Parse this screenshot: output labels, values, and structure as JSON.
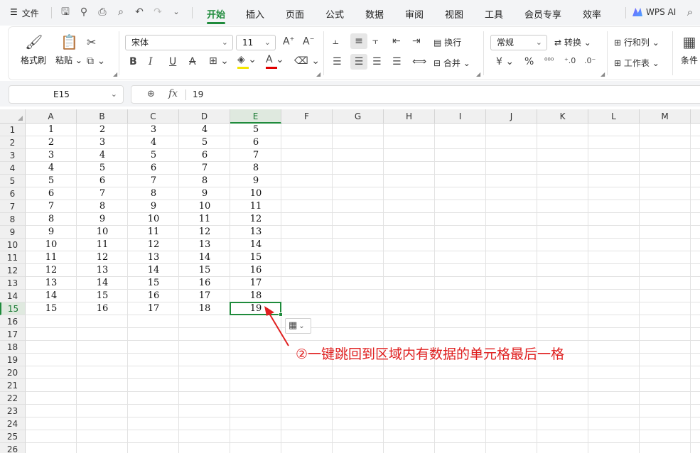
{
  "menubar": {
    "menu_label": "文件",
    "tabs": [
      "开始",
      "插入",
      "页面",
      "公式",
      "数据",
      "审阅",
      "视图",
      "工具",
      "会员专享",
      "效率"
    ],
    "active_tab": "开始",
    "ai_label": "WPS AI"
  },
  "ribbon": {
    "format_painter": "格式刷",
    "paste": "粘贴",
    "font_name": "宋体",
    "font_size": "11",
    "wrap": "换行",
    "merge": "合并",
    "number_format": "常规",
    "convert": "转换",
    "row_col": "行和列",
    "worksheet": "工作表",
    "conditional": "条件",
    "bold": "B",
    "italic": "I",
    "underline": "U",
    "strike": "A",
    "currency": "¥",
    "percent": "%",
    "font_color_hex": "#e00000",
    "fill_color_hex": "#f5e600"
  },
  "formula": {
    "name_box": "E15",
    "fx_label": "fx",
    "value": "19"
  },
  "grid": {
    "columns": [
      "A",
      "B",
      "C",
      "D",
      "E",
      "F",
      "G",
      "H",
      "I",
      "J",
      "K",
      "L",
      "M"
    ],
    "row_numbers": [
      "1",
      "2",
      "3",
      "4",
      "5",
      "6",
      "7",
      "8",
      "9",
      "10",
      "11",
      "12",
      "13",
      "14",
      "15",
      "16",
      "17",
      "18",
      "19",
      "20",
      "21",
      "22",
      "23",
      "24",
      "25",
      "26"
    ],
    "active_column": "E",
    "active_row": "15",
    "data": [
      [
        "1",
        "2",
        "3",
        "4",
        "5"
      ],
      [
        "2",
        "3",
        "4",
        "5",
        "6"
      ],
      [
        "3",
        "4",
        "5",
        "6",
        "7"
      ],
      [
        "4",
        "5",
        "6",
        "7",
        "8"
      ],
      [
        "5",
        "6",
        "7",
        "8",
        "9"
      ],
      [
        "6",
        "7",
        "8",
        "9",
        "10"
      ],
      [
        "7",
        "8",
        "9",
        "10",
        "11"
      ],
      [
        "8",
        "9",
        "10",
        "11",
        "12"
      ],
      [
        "9",
        "10",
        "11",
        "12",
        "13"
      ],
      [
        "10",
        "11",
        "12",
        "13",
        "14"
      ],
      [
        "11",
        "12",
        "13",
        "14",
        "15"
      ],
      [
        "12",
        "13",
        "14",
        "15",
        "16"
      ],
      [
        "13",
        "14",
        "15",
        "16",
        "17"
      ],
      [
        "14",
        "15",
        "16",
        "17",
        "18"
      ],
      [
        "15",
        "16",
        "17",
        "18",
        "19"
      ]
    ],
    "accent_color": "#1f8b3c"
  },
  "annotation": {
    "text": "②一键跳回到区域内有数据的单元格最后一格",
    "color": "#e02020"
  }
}
